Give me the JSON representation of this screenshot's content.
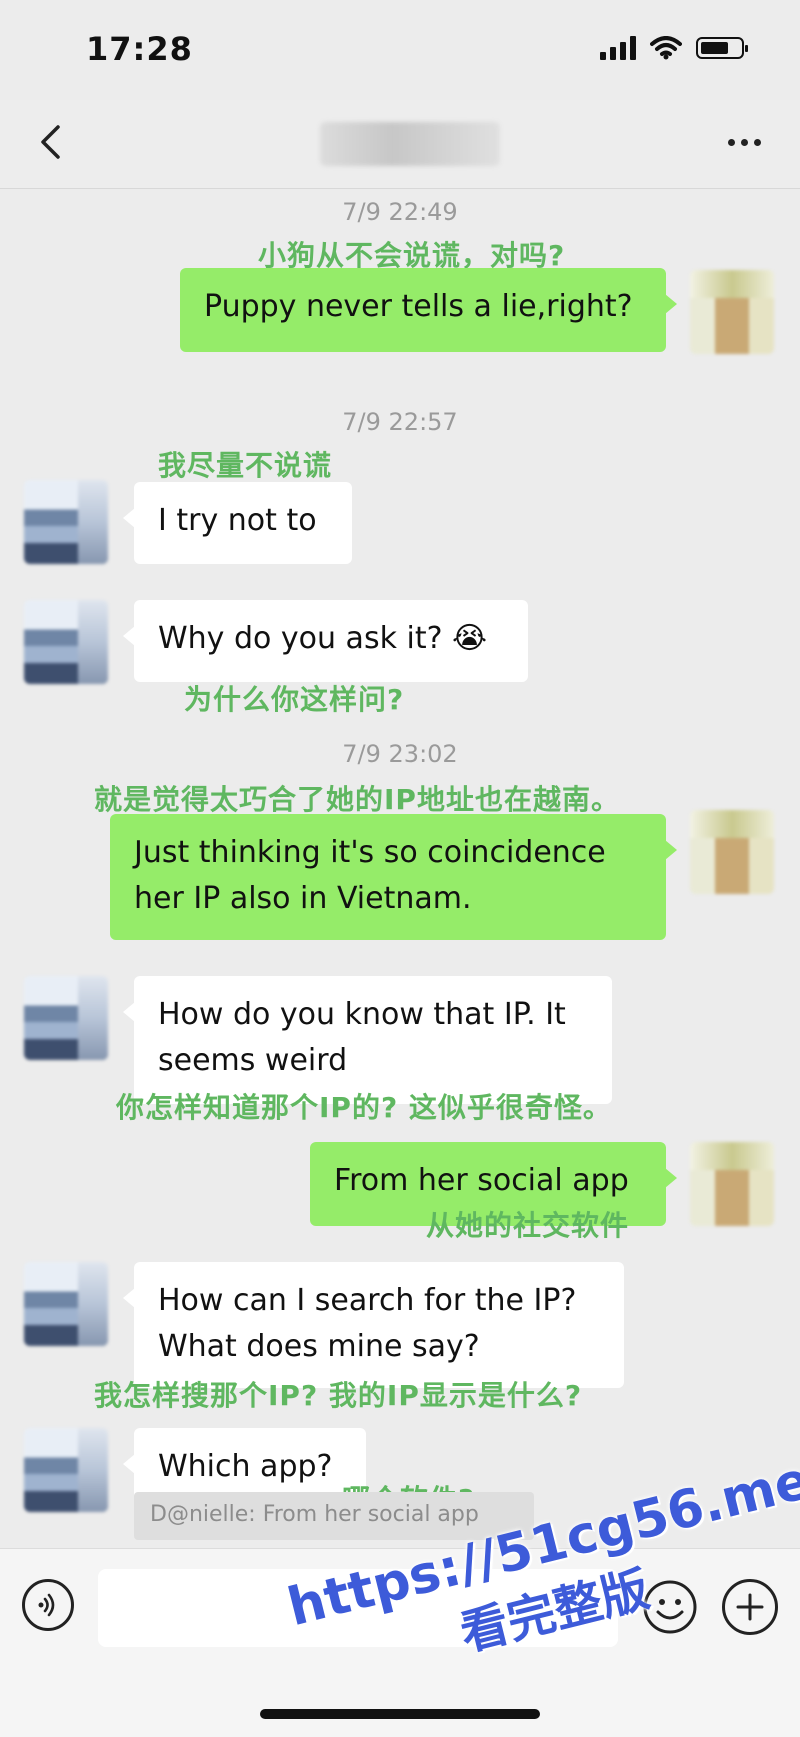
{
  "status": {
    "time": "17:28",
    "battery_level": 0.7
  },
  "nav": {
    "back_icon": "chevron-left-icon",
    "more_icon": "ellipsis-icon"
  },
  "messages": [
    {
      "timestamp": "7/9 22:49"
    },
    {
      "text": "Puppy never tells a lie,right?",
      "side": "out",
      "annotation": "小狗从不会说谎，对吗?"
    },
    {
      "timestamp": "7/9 22:57"
    },
    {
      "text": "I try not to",
      "side": "in",
      "annotation": "我尽量不说谎"
    },
    {
      "text": "Why do you ask it? 😭",
      "side": "in",
      "annotation": "为什么你这样问?"
    },
    {
      "timestamp": "7/9 23:02"
    },
    {
      "text": "Just thinking it's so coincidence\nher IP also in Vietnam.",
      "side": "out",
      "annotation": "就是觉得太巧合了她的IP地址也在越南。"
    },
    {
      "text": "How do you know that IP. It\nseems weird",
      "side": "in",
      "annotation": "你怎样知道那个IP的? 这似乎很奇怪。"
    },
    {
      "text": "From her social app",
      "side": "out",
      "annotation": "从她的社交软件"
    },
    {
      "text": "How can I search for the IP?\nWhat does mine say?",
      "side": "in",
      "annotation": "我怎样搜那个IP? 我的IP显示是什么?"
    },
    {
      "text": "Which app?",
      "side": "in",
      "annotation": "哪个软件?"
    }
  ],
  "quote": {
    "text": "D@nielle: From her social app"
  },
  "input": {
    "placeholder": ""
  },
  "watermark": {
    "url": "https://51cg56.me",
    "subtitle": "看完整版"
  },
  "colors": {
    "outgoing_bubble": "#95ec69",
    "incoming_bubble": "#ffffff",
    "annotation": "#5fb760",
    "watermark": "#3d5bd9",
    "background": "#ececec"
  }
}
